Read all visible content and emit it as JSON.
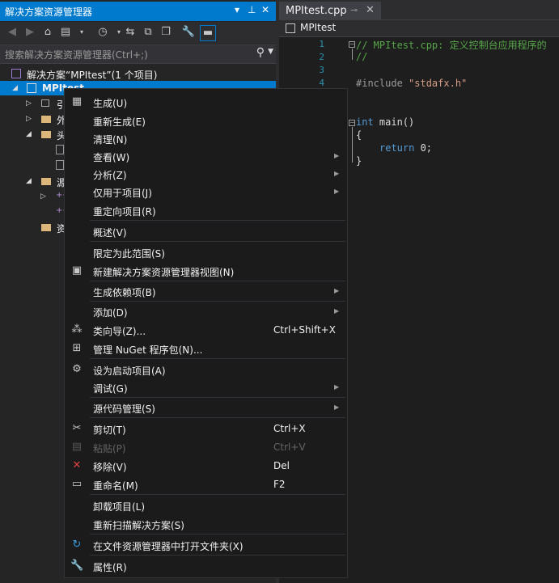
{
  "solution_explorer": {
    "title": "解决方案资源管理器",
    "search_placeholder": "搜索解决方案资源管理器(Ctrl+;)",
    "tree": {
      "solution_label": "解决方案“MPItest”(1 个项目)",
      "project_label": "MPItest",
      "partial_rows": [
        "引",
        "外",
        "头",
        "源",
        "资"
      ]
    }
  },
  "editor": {
    "tab_label": "MPItest.cpp",
    "nav_label": "MPItest",
    "line_numbers": [
      "1",
      "2",
      "3",
      "4"
    ],
    "code": {
      "line1": "// MPItest.cpp: 定义控制台应用程序的",
      "line2": "//",
      "include_kw": "#include",
      "include_str": "\"stdafx.h\"",
      "main_kw": "int",
      "main_rest": " main()",
      "open_brace": "{",
      "return_kw": "return",
      "return_rest": " 0;",
      "close_brace": "}"
    }
  },
  "context_menu": {
    "items": [
      {
        "label": "生成(U)",
        "shortcut": "",
        "icon": "build-icon"
      },
      {
        "label": "重新生成(E)",
        "shortcut": "",
        "icon": ""
      },
      {
        "label": "清理(N)",
        "shortcut": "",
        "icon": ""
      },
      {
        "label": "查看(W)",
        "shortcut": "",
        "icon": ""
      },
      {
        "label": "分析(Z)",
        "shortcut": "",
        "icon": ""
      },
      {
        "label": "仅用于项目(J)",
        "shortcut": "",
        "icon": ""
      },
      {
        "label": "重定向项目(R)",
        "shortcut": "",
        "icon": ""
      },
      {
        "label": "概述(V)",
        "shortcut": "",
        "icon": ""
      },
      {
        "label": "限定为此范围(S)",
        "shortcut": "",
        "icon": ""
      },
      {
        "label": "新建解决方案资源管理器视图(N)",
        "shortcut": "",
        "icon": "new-view-icon"
      },
      {
        "label": "生成依赖项(B)",
        "shortcut": "",
        "icon": ""
      },
      {
        "label": "添加(D)",
        "shortcut": "",
        "icon": ""
      },
      {
        "label": "类向导(Z)...",
        "shortcut": "Ctrl+Shift+X",
        "icon": "class-wizard-icon"
      },
      {
        "label": "管理 NuGet 程序包(N)...",
        "shortcut": "",
        "icon": "nuget-icon"
      },
      {
        "label": "设为启动项目(A)",
        "shortcut": "",
        "icon": "gear-icon"
      },
      {
        "label": "调试(G)",
        "shortcut": "",
        "icon": ""
      },
      {
        "label": "源代码管理(S)",
        "shortcut": "",
        "icon": ""
      },
      {
        "label": "剪切(T)",
        "shortcut": "Ctrl+X",
        "icon": "scissors-icon"
      },
      {
        "label": "粘贴(P)",
        "shortcut": "Ctrl+V",
        "icon": "paste-icon"
      },
      {
        "label": "移除(V)",
        "shortcut": "Del",
        "icon": "remove-icon"
      },
      {
        "label": "重命名(M)",
        "shortcut": "F2",
        "icon": "rename-icon"
      },
      {
        "label": "卸载项目(L)",
        "shortcut": "",
        "icon": ""
      },
      {
        "label": "重新扫描解决方案(S)",
        "shortcut": "",
        "icon": ""
      },
      {
        "label": "在文件资源管理器中打开文件夹(X)",
        "shortcut": "",
        "icon": "open-folder-icon"
      },
      {
        "label": "属性(R)",
        "shortcut": "",
        "icon": "wrench-icon"
      }
    ]
  },
  "colors": {
    "accent": "#007acc",
    "menu_bg": "#1b1b1c",
    "editor_bg": "#1e1e1e",
    "comment": "#57a64a",
    "keyword": "#569cd6",
    "string": "#d69d85"
  }
}
